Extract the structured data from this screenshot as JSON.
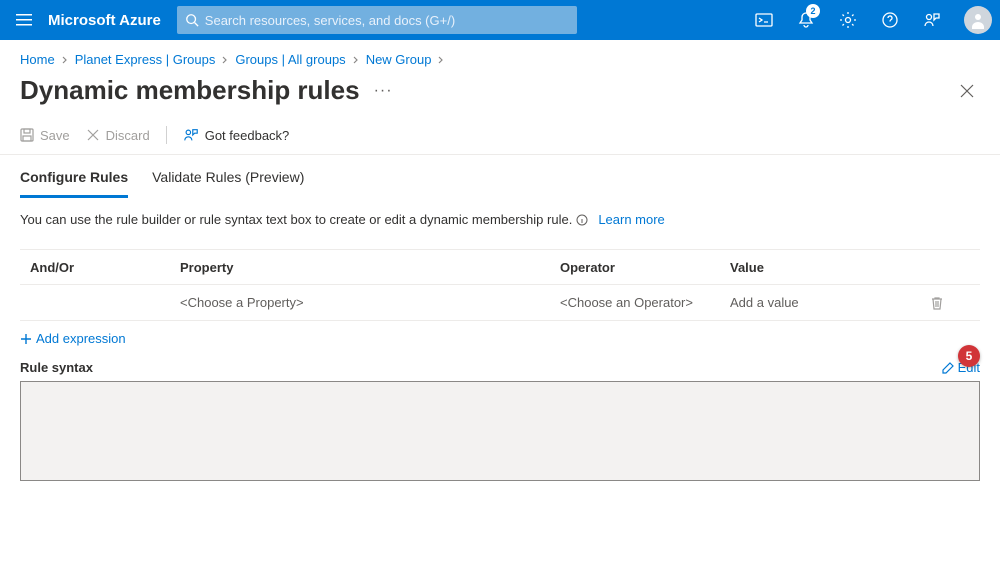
{
  "topbar": {
    "brand": "Microsoft Azure",
    "search_placeholder": "Search resources, services, and docs (G+/)",
    "notification_count": "2"
  },
  "breadcrumb": {
    "items": [
      "Home",
      "Planet Express | Groups",
      "Groups | All groups",
      "New Group"
    ]
  },
  "page": {
    "title": "Dynamic membership rules"
  },
  "commands": {
    "save": "Save",
    "discard": "Discard",
    "feedback": "Got feedback?"
  },
  "tabs": {
    "configure": "Configure Rules",
    "validate": "Validate Rules (Preview)"
  },
  "description": {
    "text": "You can use the rule builder or rule syntax text box to create or edit a dynamic membership rule.",
    "learn_more": "Learn more"
  },
  "table": {
    "headers": {
      "andor": "And/Or",
      "property": "Property",
      "operator": "Operator",
      "value": "Value"
    },
    "row": {
      "property": "<Choose a Property>",
      "operator": "<Choose an Operator>",
      "value": "Add a value"
    }
  },
  "actions": {
    "add_expression": "Add expression",
    "rule_syntax_title": "Rule syntax",
    "edit": "Edit"
  },
  "float_badge": "5"
}
